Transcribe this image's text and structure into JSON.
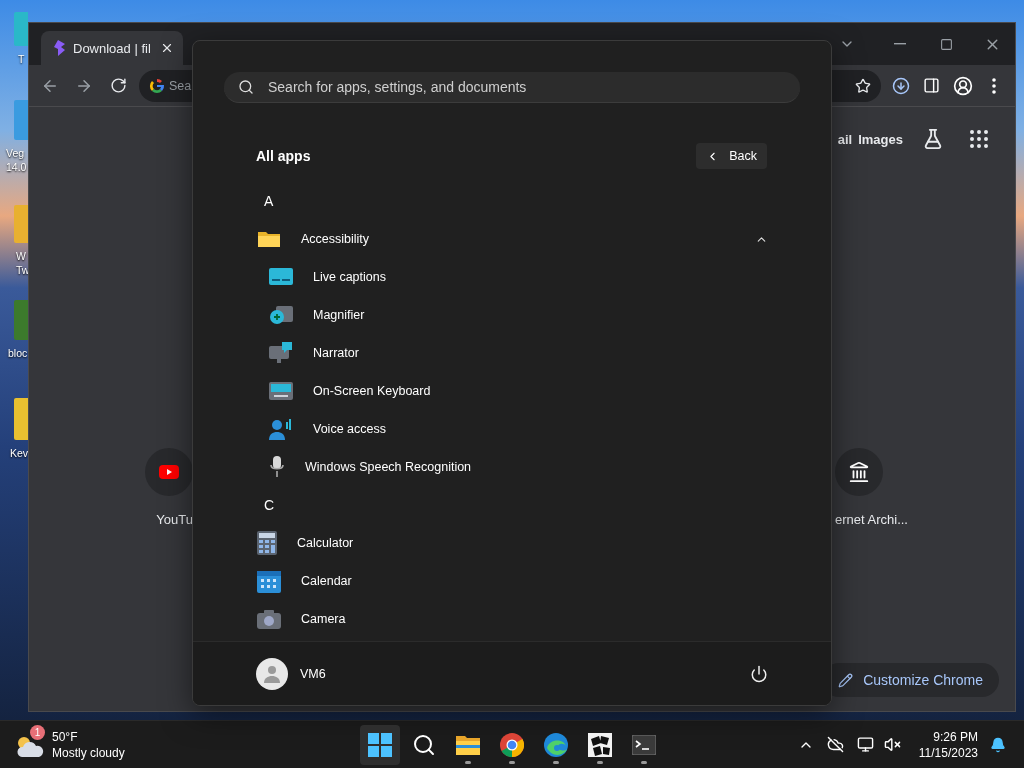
{
  "desktop": {
    "icons": [
      {
        "lines": [
          "T"
        ]
      },
      {
        "lines": [
          "Veg",
          "14.0"
        ]
      },
      {
        "lines": [
          "W",
          "Tw"
        ]
      },
      {
        "lines": [
          "bloc"
        ]
      },
      {
        "lines": [
          "Kev"
        ]
      }
    ]
  },
  "browser": {
    "tabs": [
      {
        "title": "Download | fil",
        "selected": true
      }
    ],
    "omnibox": {
      "placeholder": "Sea"
    },
    "header_links": [
      "ail",
      "Images"
    ],
    "shortcuts": [
      {
        "label": "YouTu"
      },
      {
        "label": "ernet Archi..."
      }
    ],
    "customize_button": "Customize Chrome"
  },
  "start_menu": {
    "search": {
      "placeholder": "Search for apps, settings, and documents"
    },
    "title": "All apps",
    "back_button": "Back",
    "apps": [
      {
        "kind": "letter",
        "label": "A"
      },
      {
        "kind": "folder",
        "label": "Accessibility",
        "expanded": true,
        "children": [
          {
            "label": "Live captions"
          },
          {
            "label": "Magnifier"
          },
          {
            "label": "Narrator"
          },
          {
            "label": "On-Screen Keyboard"
          },
          {
            "label": "Voice access"
          },
          {
            "label": "Windows Speech Recognition"
          }
        ]
      },
      {
        "kind": "letter",
        "label": "C"
      },
      {
        "kind": "app",
        "label": "Calculator"
      },
      {
        "kind": "app",
        "label": "Calendar"
      },
      {
        "kind": "app",
        "label": "Camera"
      }
    ],
    "user": {
      "name": "VM6"
    }
  },
  "taskbar": {
    "weather": {
      "badge": "1",
      "temperature": "50°F",
      "condition": "Mostly cloudy"
    },
    "apps": [
      {
        "kind": "start",
        "selected": true,
        "running": false
      },
      {
        "kind": "search",
        "selected": false,
        "running": false
      },
      {
        "kind": "explorer",
        "selected": false,
        "running": true
      },
      {
        "kind": "chrome",
        "selected": false,
        "running": true
      },
      {
        "kind": "edge",
        "selected": false,
        "running": true
      },
      {
        "kind": "grid",
        "selected": false,
        "running": true
      },
      {
        "kind": "terminal",
        "selected": false,
        "running": true
      }
    ],
    "clock": {
      "time": "9:26 PM",
      "date": "11/15/2023"
    }
  }
}
